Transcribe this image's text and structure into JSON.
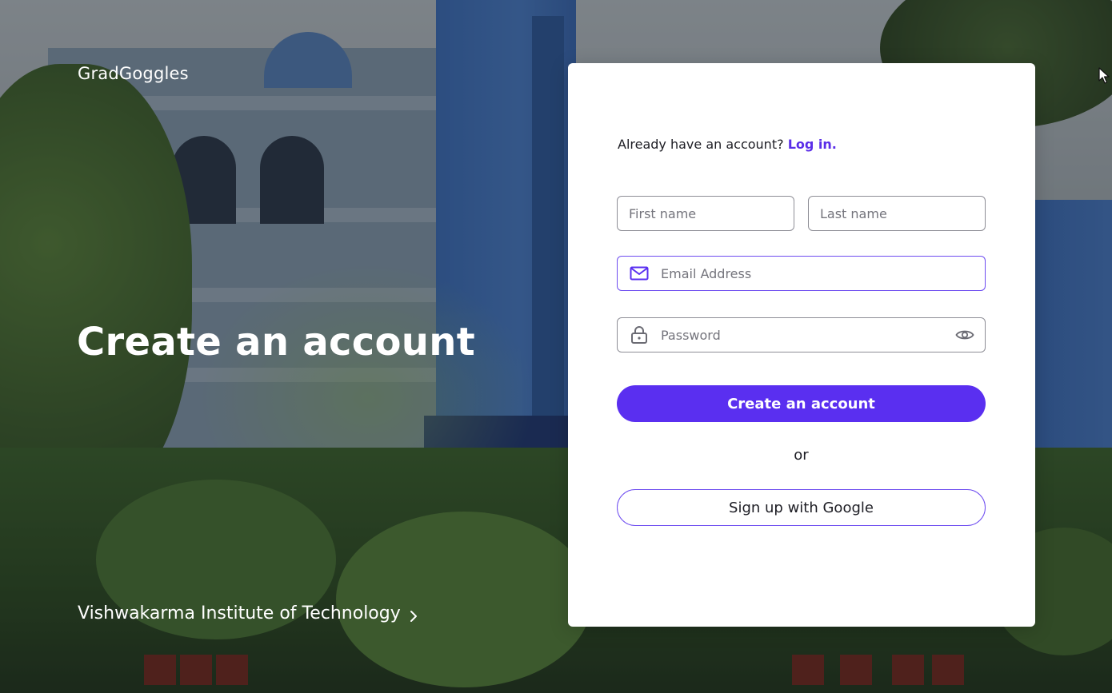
{
  "app": {
    "brand": "GradGoggles"
  },
  "hero": {
    "title": "Create an account",
    "institute_link": "Vishwakarma Institute of Technology"
  },
  "form": {
    "login_prompt": "Already have an account?",
    "login_link": "Log in.",
    "first_name_placeholder": "First name",
    "last_name_placeholder": "Last name",
    "email_placeholder": "Email Address",
    "password_placeholder": "Password",
    "submit_label": "Create an account",
    "divider_text": "or",
    "google_label": "Sign up with Google"
  },
  "icons": {
    "email": "mail-icon",
    "password": "lock-icon",
    "toggle_visibility": "eye-icon",
    "institute_chevron": "chevron-right-icon"
  },
  "colors": {
    "accent": "#5a2ff0",
    "link": "#5b2ee8",
    "focus_border": "#6d4cf0"
  }
}
